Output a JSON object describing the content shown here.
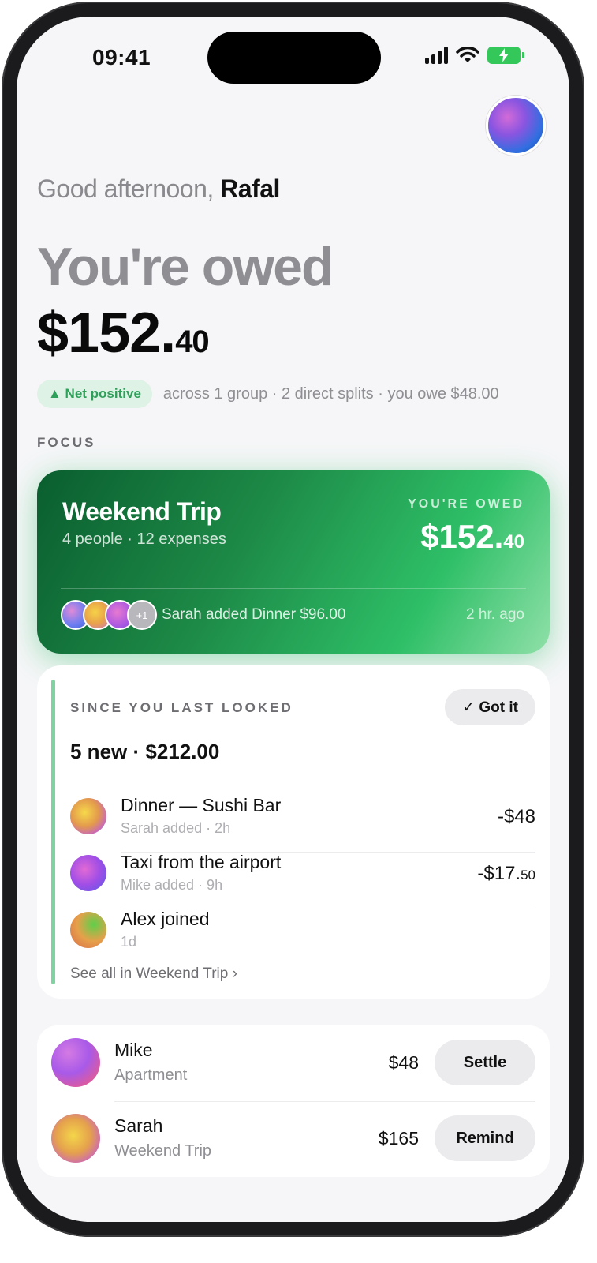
{
  "status_bar": {
    "time": "09:41"
  },
  "greeting": {
    "prefix": "Good afternoon, ",
    "name": "Rafal"
  },
  "balance": {
    "title": "You're owed",
    "amount_main": "$152.",
    "amount_cents": "40",
    "badge": "▲ Net positive",
    "summary": "across 1 group · 2 direct splits · you owe $48.00"
  },
  "focus": {
    "label": "FOCUS",
    "card": {
      "name": "Weekend Trip",
      "meta": "4 people · 12 expenses",
      "owed_label": "YOU'RE OWED",
      "owed_main": "$152.",
      "owed_cents": "40",
      "more_members": "+1",
      "activity": "Sarah added Dinner $96.00",
      "time": "2 hr. ago"
    }
  },
  "since": {
    "label": "SINCE YOU LAST LOOKED",
    "got_it": "✓ Got it",
    "summary": "5 new · $212.00",
    "items": [
      {
        "title": "Dinner — Sushi Bar",
        "sub": "Sarah added · 2h",
        "amount_main": "-$48",
        "amount_cents": ""
      },
      {
        "title": "Taxi from the airport",
        "sub": "Mike added · 9h",
        "amount_main": "-$17.",
        "amount_cents": "50"
      },
      {
        "title": "Alex joined",
        "sub": "1d",
        "amount_main": "",
        "amount_cents": ""
      }
    ],
    "see_all": "See all in Weekend Trip ›"
  },
  "people": [
    {
      "name": "Mike",
      "group": "Apartment",
      "amount": "$48",
      "action": "Settle"
    },
    {
      "name": "Sarah",
      "group": "Weekend Trip",
      "amount": "$165",
      "action": "Remind"
    }
  ],
  "colors": {
    "accent_green": "#2ebf67",
    "badge_green": "#2fa05a"
  }
}
